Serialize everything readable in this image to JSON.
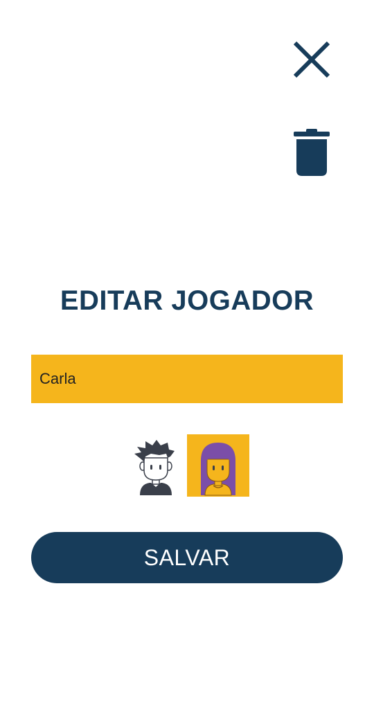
{
  "header": {
    "close_icon": "close-icon",
    "delete_icon": "trash-icon"
  },
  "page": {
    "title": "EDITAR JOGADOR"
  },
  "form": {
    "name_value": "Carla"
  },
  "avatars": {
    "options": [
      {
        "icon": "male-avatar-icon",
        "selected": false
      },
      {
        "icon": "female-avatar-icon",
        "selected": true
      }
    ]
  },
  "actions": {
    "save_label": "SALVAR"
  },
  "colors": {
    "primary": "#173c5a",
    "accent": "#f5b51c",
    "avatar_hair_female": "#7b4ea8",
    "avatar_hair_male": "#3a3f4a"
  }
}
